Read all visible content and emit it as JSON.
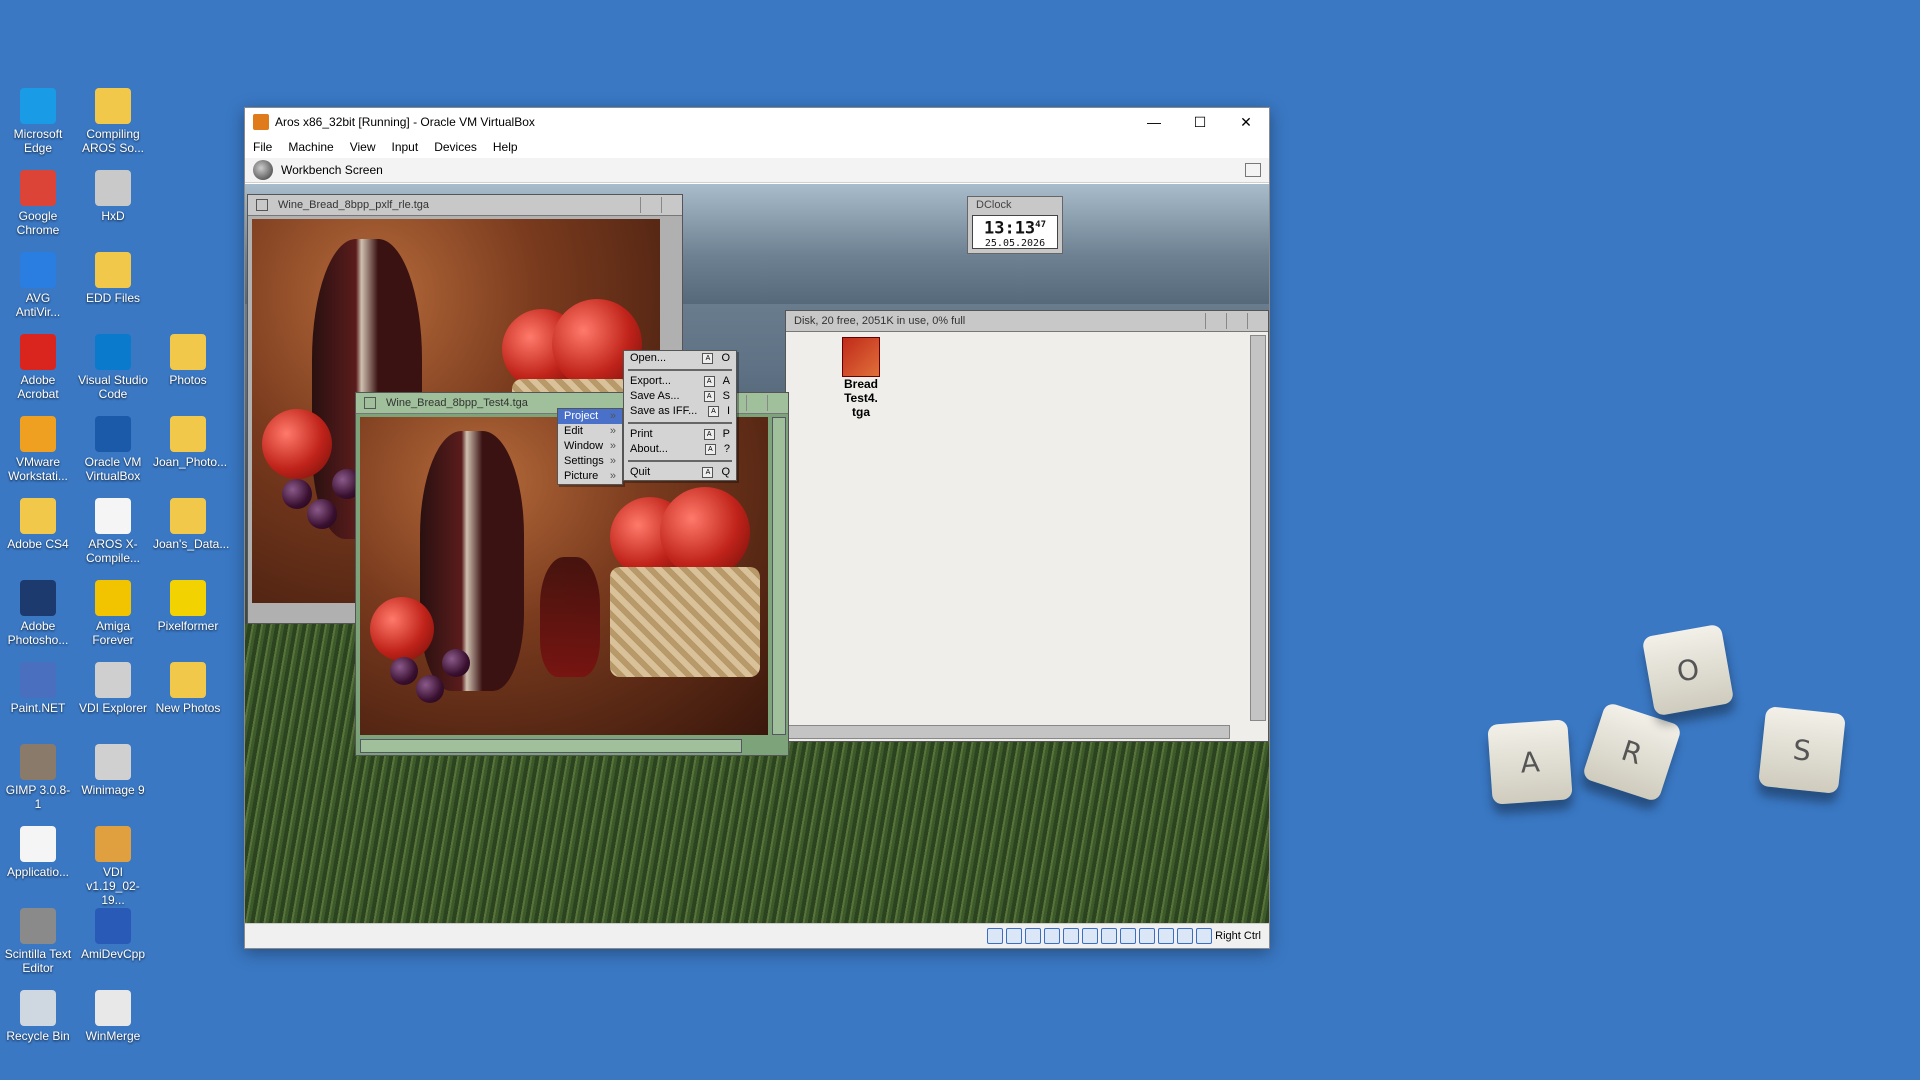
{
  "desktop": {
    "icons": [
      {
        "label": "Microsoft Edge",
        "icon": "edge-icon",
        "color": "#1a9be6"
      },
      {
        "label": "Compiling AROS So...",
        "icon": "file-icon",
        "color": "#f2c84b"
      },
      {
        "label": "Google Chrome",
        "icon": "chrome-icon",
        "color": "#db4437"
      },
      {
        "label": "HxD",
        "icon": "hxd-icon",
        "color": "#c9c9c9"
      },
      {
        "label": "AVG AntiVir...",
        "icon": "avg-icon",
        "color": "#2a7de1"
      },
      {
        "label": "EDD Files",
        "icon": "file-icon",
        "color": "#f2c84b"
      },
      {
        "label": "Adobe Acrobat",
        "icon": "acrobat-icon",
        "color": "#d9251d"
      },
      {
        "label": "Visual Studio Code",
        "icon": "vscode-icon",
        "color": "#0a7acc"
      },
      {
        "label": "Photos",
        "icon": "photos-icon",
        "color": "#f2c84b"
      },
      {
        "label": "VMware Workstati...",
        "icon": "vmware-icon",
        "color": "#f0a020"
      },
      {
        "label": "Oracle VM VirtualBox",
        "icon": "virtualbox-icon",
        "color": "#1b5aa8"
      },
      {
        "label": "Joan_Photo...",
        "icon": "folder-icon",
        "color": "#f2c84b"
      },
      {
        "label": "Adobe CS4",
        "icon": "folder-icon",
        "color": "#f2c84b"
      },
      {
        "label": "AROS X-Compile...",
        "icon": "document-icon",
        "color": "#f5f5f5"
      },
      {
        "label": "Joan's_Data...",
        "icon": "folder-icon",
        "color": "#f2c84b"
      },
      {
        "label": "Adobe Photosho...",
        "icon": "photoshop-icon",
        "color": "#1d3a6e"
      },
      {
        "label": "Amiga Forever",
        "icon": "amiga-forever-icon",
        "color": "#f2c400"
      },
      {
        "label": "Pixelformer",
        "icon": "pixelformer-icon",
        "color": "#f2d200"
      },
      {
        "label": "Paint.NET",
        "icon": "paintnet-icon",
        "color": "#4b6fbf"
      },
      {
        "label": "VDI Explorer",
        "icon": "disc-icon",
        "color": "#cfcfcf"
      },
      {
        "label": "New Photos",
        "icon": "folder-icon",
        "color": "#f2c84b"
      },
      {
        "label": "GIMP 3.0.8-1",
        "icon": "gimp-icon",
        "color": "#8a7a6a"
      },
      {
        "label": "Winimage 9",
        "icon": "winimage-icon",
        "color": "#d0d0d0"
      },
      {
        "label": "Applicatio...",
        "icon": "document-icon",
        "color": "#f5f5f5"
      },
      {
        "label": "VDI v1.19_02-19...",
        "icon": "archive-icon",
        "color": "#e0a040"
      },
      {
        "label": "Scintilla Text Editor",
        "icon": "scintilla-icon",
        "color": "#8a8a8a"
      },
      {
        "label": "AmiDevCpp",
        "icon": "amidevcpp-icon",
        "color": "#2a5ab8"
      },
      {
        "label": "Recycle Bin",
        "icon": "recycle-bin-icon",
        "color": "#cfd8e0"
      },
      {
        "label": "WinMerge",
        "icon": "winmerge-icon",
        "color": "#e8e8e8"
      }
    ]
  },
  "vbox": {
    "title": "Aros x86_32bit [Running] - Oracle VM VirtualBox",
    "menu": [
      "File",
      "Machine",
      "View",
      "Input",
      "Devices",
      "Help"
    ],
    "screen_label": "Workbench Screen",
    "status_right": "Right Ctrl"
  },
  "aros": {
    "win1_title": "Wine_Bread_8bpp_pxlf_rle.tga",
    "win2_title": "Wine_Bread_8bpp_Test4.tga",
    "drawer_title": "Disk, 20 free, 2051K in use, 0% full",
    "file_icon_label": "Bread Test4.",
    "file_icon_label2": "tga",
    "dclock_title": "DClock",
    "dclock_time": "13:13",
    "dclock_seconds": "47",
    "dclock_date": "25.05.2026",
    "menu_bar": [
      "Project",
      "Edit",
      "Window",
      "Settings",
      "Picture"
    ],
    "submenu": [
      {
        "label": "Open...",
        "key": "O"
      },
      {
        "label": "Export...",
        "key": "A"
      },
      {
        "label": "Save As...",
        "key": "S"
      },
      {
        "label": "Save as IFF...",
        "key": "I"
      },
      {
        "label": "Print",
        "key": "P"
      },
      {
        "label": "About...",
        "key": "?"
      },
      {
        "label": "Quit",
        "key": "Q"
      }
    ]
  },
  "keycaps": [
    "A",
    "R",
    "O",
    "S"
  ]
}
